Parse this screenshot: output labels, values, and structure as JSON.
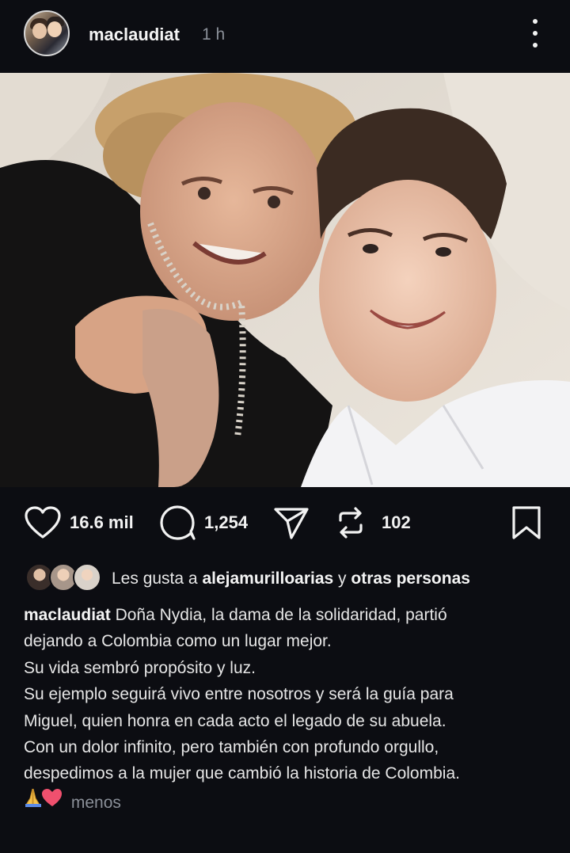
{
  "post": {
    "username": "maclaudiat",
    "time": "1 h"
  },
  "actions": {
    "likes": "16.6 mil",
    "comments": "1,254",
    "reposts": "102"
  },
  "liked_by": {
    "prefix": "Les gusta a",
    "user": "alejamurilloarias",
    "connector": "y",
    "others": "otras personas"
  },
  "caption": {
    "username": "maclaudiat",
    "lines": [
      "Doña Nydia, la dama de la solidaridad, partió",
      "dejando a Colombia como un lugar mejor.",
      "Su vida sembró propósito y luz.",
      "Su ejemplo seguirá vivo entre nosotros y será la guía para",
      "Miguel, quien honra en cada acto el legado de su abuela.",
      "Con un dolor infinito, pero también con profundo orgullo,",
      "despedimos a la mujer que cambió la historia de Colombia."
    ],
    "emojis": "🙏❤",
    "less_label": "menos"
  },
  "colors": {
    "background": "#0c0d12",
    "text": "#f2f2f2",
    "muted": "#8a8f98"
  },
  "icons": [
    "avatar",
    "more-vertical-icon",
    "heart-icon",
    "comment-icon",
    "share-icon",
    "repost-icon",
    "bookmark-icon",
    "pray-emoji",
    "heart-emoji"
  ]
}
